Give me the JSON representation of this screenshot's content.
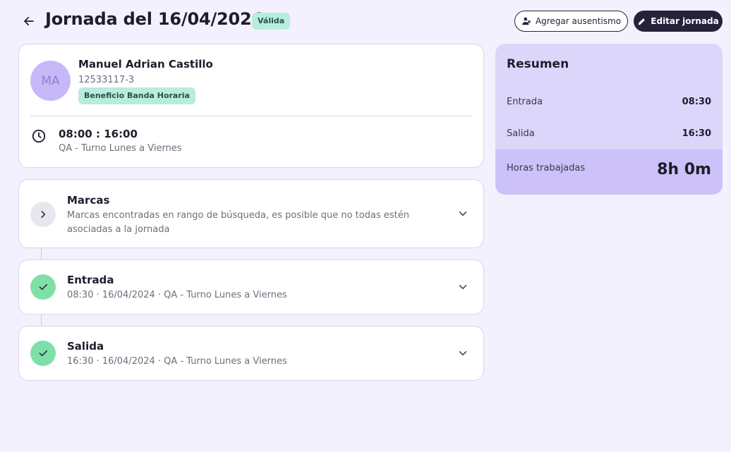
{
  "header": {
    "title": "Jornada del 16/04/2024",
    "status": "Válida",
    "add_absence_label": "Agregar ausentismo",
    "edit_label": "Editar jornada"
  },
  "employee": {
    "initials": "MA",
    "name": "Manuel Adrian Castillo",
    "id": "12533117-3",
    "benefit": "Beneficio Banda Horaria",
    "shift_time": "08:00 : 16:00",
    "shift_name": "QA - Turno Lunes a Viernes"
  },
  "marcas": {
    "title": "Marcas",
    "description": "Marcas encontradas en rango de búsqueda, es posible que no todas estén asociadas a la jornada"
  },
  "entries": [
    {
      "title": "Entrada",
      "detail": "08:30 · 16/04/2024 · QA - Turno Lunes a Viernes"
    },
    {
      "title": "Salida",
      "detail": "16:30 · 16/04/2024 · QA - Turno Lunes a Viernes"
    }
  ],
  "summary": {
    "title": "Resumen",
    "rows": [
      {
        "label": "Entrada",
        "value": "08:30"
      },
      {
        "label": "Salida",
        "value": "16:30"
      }
    ],
    "total_label": "Horas trabajadas",
    "total_value": "8h 0m"
  },
  "icons": {
    "back": "arrow-left-icon",
    "add_absence": "person-remove-icon",
    "edit": "pencil-icon",
    "clock": "clock-icon",
    "marcas": "chevron-right-icon",
    "check": "check-icon",
    "expand": "chevron-down-icon"
  },
  "colors": {
    "background": "#f3f1fd",
    "accent_dark": "#25233a",
    "badge_green": "#b8ecdd",
    "check_green": "#7fe0a7",
    "summary_bg": "#ddd6fb",
    "avatar_bg": "#c7b9f7"
  }
}
